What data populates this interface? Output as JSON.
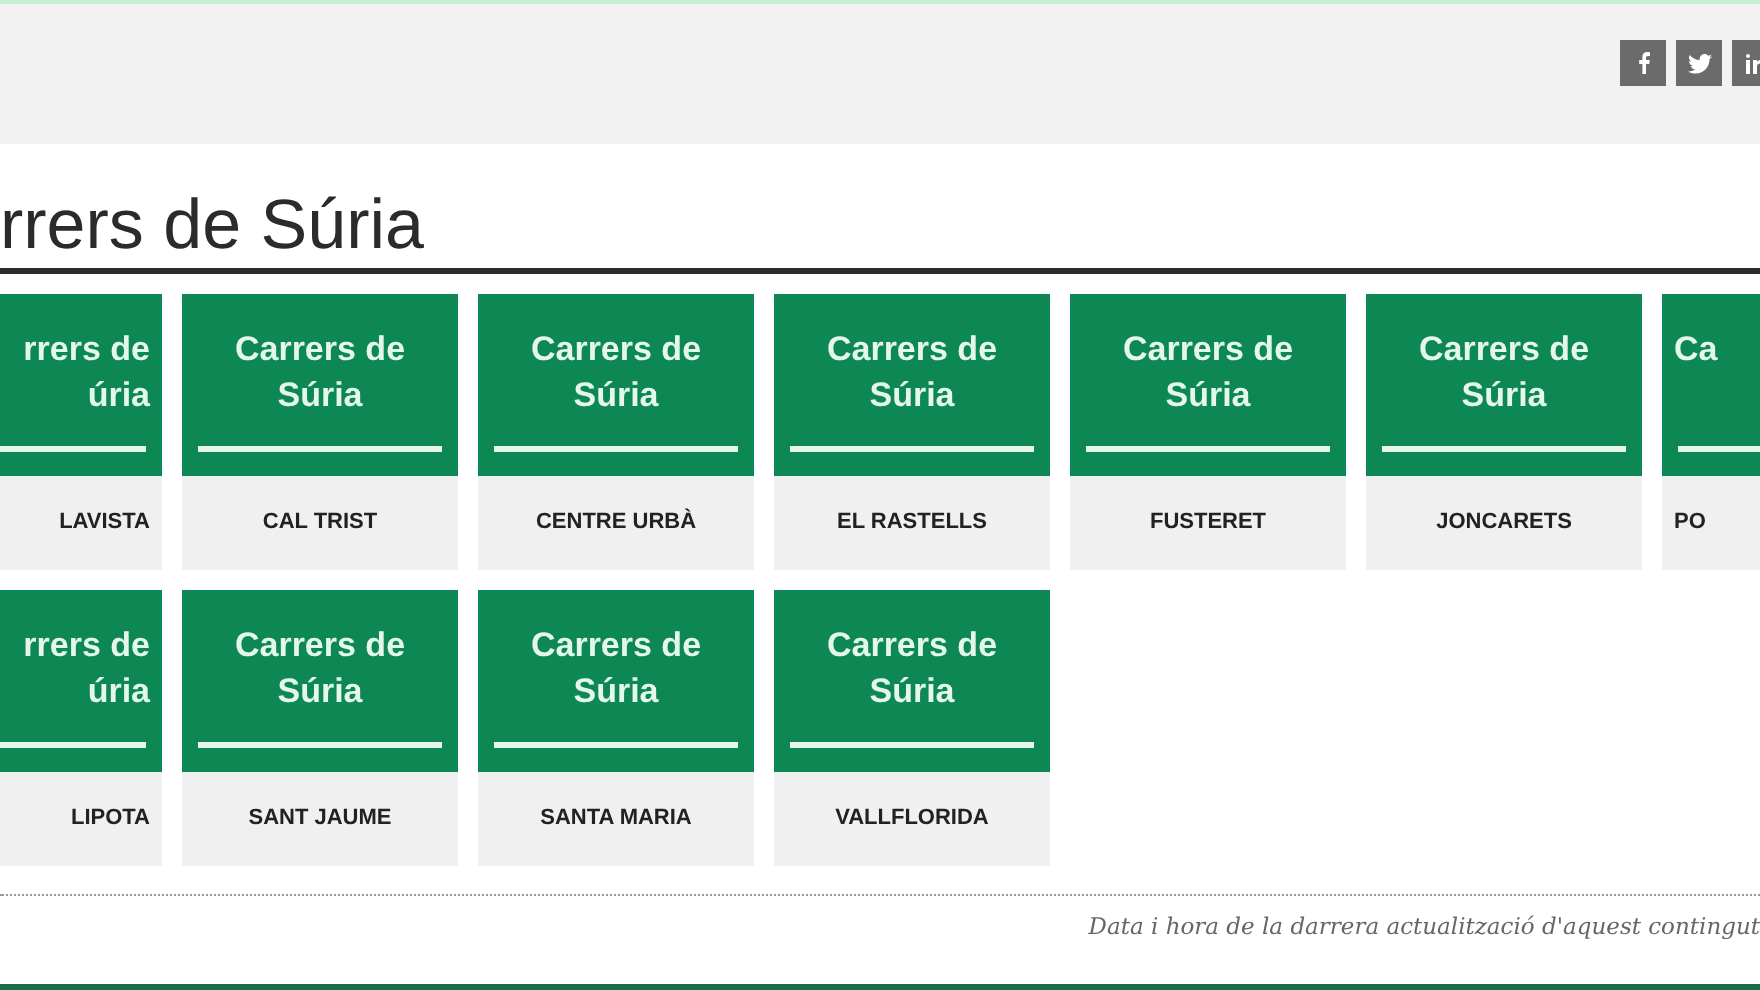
{
  "title": "rrers de Súria",
  "rows": [
    [
      {
        "heading": [
          "rrers de",
          "úria"
        ],
        "name": "LAVISTA"
      },
      {
        "heading": [
          "Carrers de",
          "Súria"
        ],
        "name": "CAL TRIST"
      },
      {
        "heading": [
          "Carrers de",
          "Súria"
        ],
        "name": "CENTRE URBÀ"
      },
      {
        "heading": [
          "Carrers de",
          "Súria"
        ],
        "name": "EL RASTELLS"
      },
      {
        "heading": [
          "Carrers de",
          "Súria"
        ],
        "name": "FUSTERET"
      },
      {
        "heading": [
          "Carrers de",
          "Súria"
        ],
        "name": "JONCARETS"
      },
      {
        "heading": [
          "Ca"
        ],
        "name": "PO"
      }
    ],
    [
      {
        "heading": [
          "rrers de",
          "úria"
        ],
        "name": "LIPOTA"
      },
      {
        "heading": [
          "Carrers de",
          "Súria"
        ],
        "name": "SANT JAUME"
      },
      {
        "heading": [
          "Carrers de",
          "Súria"
        ],
        "name": "SANTA MARIA"
      },
      {
        "heading": [
          "Carrers de",
          "Súria"
        ],
        "name": "VALLFLORIDA"
      }
    ]
  ],
  "footer_note": "Data i hora de la darrera actualització d'aquest contingut"
}
